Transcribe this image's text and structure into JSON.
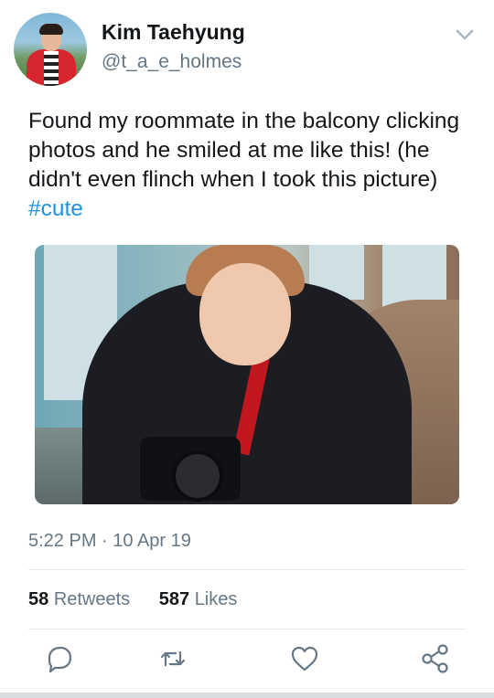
{
  "user": {
    "name": "Kim Taehyung",
    "handle": "@t_a_e_holmes"
  },
  "tweet": {
    "text": "Found my roommate in the balcony clicking photos and he smiled at me like this!  (he didn't even flinch when I took this picture) ",
    "hashtag": "#cute",
    "time": "5:22 PM · 10 Apr 19"
  },
  "stats": {
    "retweets_count": "58",
    "retweets_label": "Retweets",
    "likes_count": "587",
    "likes_label": "Likes"
  },
  "icons": {
    "menu": "chevron-down-icon",
    "reply": "reply-icon",
    "retweet": "retweet-icon",
    "like": "heart-icon",
    "share": "share-icon"
  },
  "colors": {
    "accent": "#1b95e0",
    "secondary_text": "#657786",
    "icon": "#657786"
  }
}
